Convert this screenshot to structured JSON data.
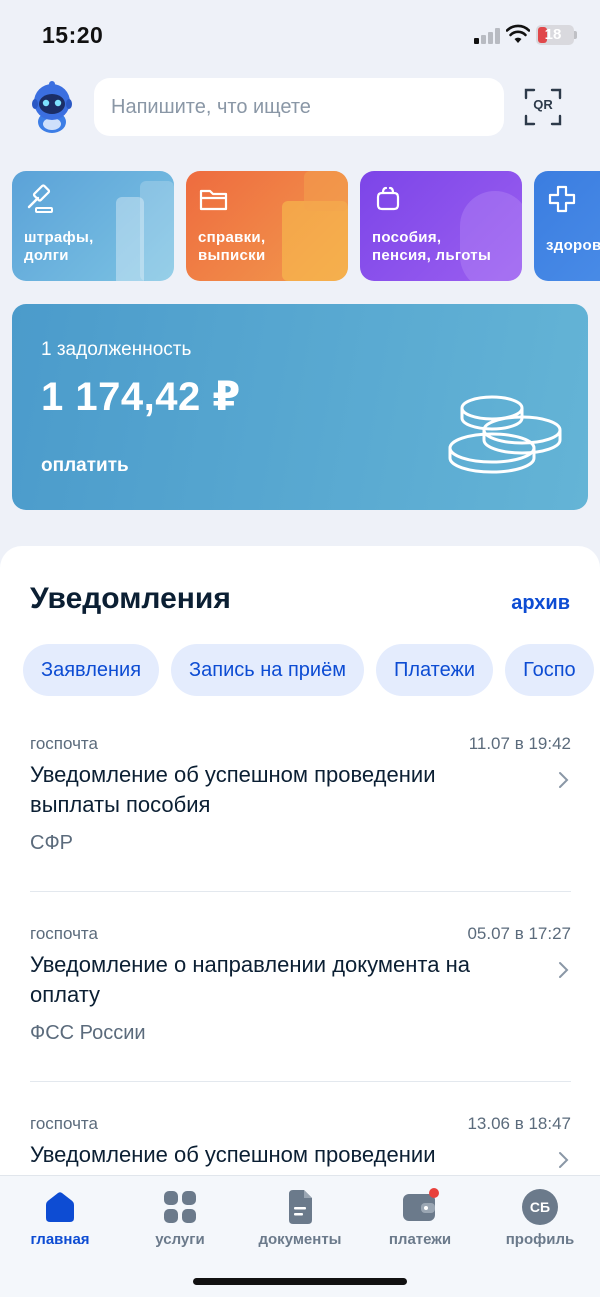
{
  "status_bar": {
    "time": "15:20",
    "battery": "18"
  },
  "search": {
    "placeholder": "Напишите, что ищете",
    "value": ""
  },
  "qr_label": "QR",
  "tiles": [
    {
      "label": "штрафы,\nдолги",
      "icon": "gavel-icon",
      "color": "#5aa7d6"
    },
    {
      "label": "справки,\nвыписки",
      "icon": "folder-icon",
      "color": "#ee7d4b"
    },
    {
      "label": "пособия,\nпенсия, льготы",
      "icon": "wallet-icon",
      "color": "#8a4ee6"
    },
    {
      "label": "здоровье",
      "icon": "cross-icon",
      "color": "#3f82e0"
    }
  ],
  "debt": {
    "count_text": "1 задолженность",
    "amount": "1 174,42 ₽",
    "pay_label": "оплатить"
  },
  "notifications": {
    "title": "Уведомления",
    "archive_label": "архив",
    "chips": [
      "Заявления",
      "Запись на приём",
      "Платежи",
      "Госпо"
    ],
    "items": [
      {
        "source": "госпочта",
        "time": "11.07 в 19:42",
        "title": "Уведомление об успешном проведении выплаты пособия",
        "org": "СФР"
      },
      {
        "source": "госпочта",
        "time": "05.07 в 17:27",
        "title": "Уведомление о направлении документа на оплату",
        "org": "ФСС России"
      },
      {
        "source": "госпочта",
        "time": "13.06 в 18:47",
        "title": "Уведомление об успешном проведении",
        "org": ""
      }
    ]
  },
  "bottom_nav": {
    "items": [
      {
        "label": "главная",
        "icon": "home-icon"
      },
      {
        "label": "услуги",
        "icon": "grid-icon"
      },
      {
        "label": "документы",
        "icon": "document-icon"
      },
      {
        "label": "платежи",
        "icon": "wallet-icon"
      },
      {
        "label": "профиль",
        "icon": "avatar-icon",
        "initials": "СБ"
      }
    ]
  },
  "colors": {
    "primary": "#0d4cd3",
    "card": "#5aa9d3",
    "text": "#0b1f33",
    "muted": "#5b6b7c"
  }
}
